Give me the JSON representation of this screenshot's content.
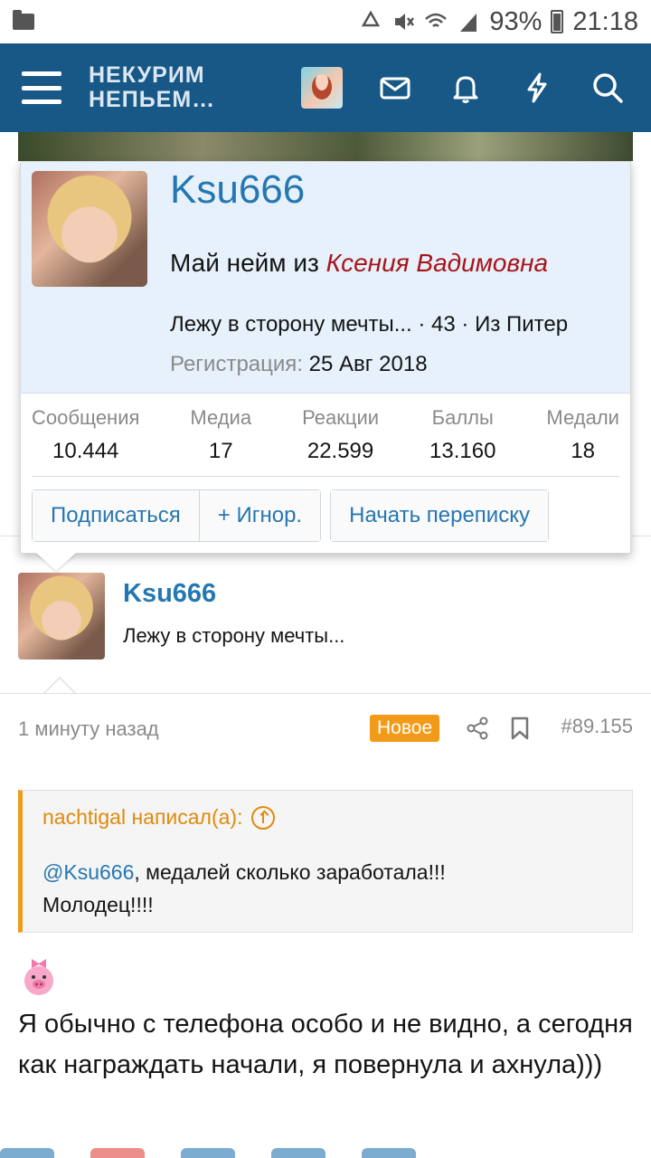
{
  "status_bar": {
    "battery": "93%",
    "time": "21:18"
  },
  "header": {
    "logo_line1": "НЕКУРИМ",
    "logo_line2": "НЕПЬЕМ…"
  },
  "profile_card": {
    "username": "Ksu666",
    "title_prefix": "Май нейм из",
    "title_name": "Ксения Вадимовна",
    "info": "Лежу в сторону мечты... · 43 · Из Питер",
    "registration_label": "Регистрация:",
    "registration_date": "25 Авг 2018",
    "stats": [
      {
        "label": "Сообщения",
        "value": "10.444"
      },
      {
        "label": "Медиа",
        "value": "17"
      },
      {
        "label": "Реакции",
        "value": "22.599"
      },
      {
        "label": "Баллы",
        "value": "13.160"
      },
      {
        "label": "Медали",
        "value": "18"
      }
    ],
    "buttons": {
      "follow": "Подписаться",
      "ignore": "+ Игнор.",
      "message": "Начать переписку"
    }
  },
  "post": {
    "username": "Ksu666",
    "status": "Лежу в сторону мечты...",
    "time": "1 минуту назад",
    "badge": "Новое",
    "post_number": "#89.155",
    "quote": {
      "author": "nachtigal написал(а):",
      "mention": "@Ksu666",
      "text_after_mention": ", медалей сколько заработала!!!",
      "text_line2": "Молодец!!!!"
    },
    "message": "Я обычно с телефона особо и не видно, а сегодня как награждать начали, я повернула и ахнула)))"
  },
  "colors": {
    "header_bg": "#185886",
    "link": "#2577b1",
    "accent": "#f29a1a",
    "title_red": "#a8141a"
  }
}
